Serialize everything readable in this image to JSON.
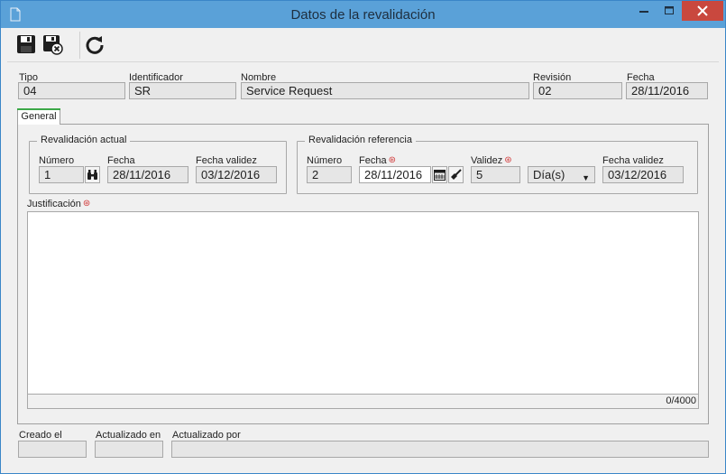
{
  "window": {
    "title": "Datos de la revalidación",
    "titlebar_color": "#5aa1d8",
    "close_color": "#c9483e"
  },
  "toolbar": {
    "buttons": [
      {
        "icon": "save-icon"
      },
      {
        "icon": "save-and-close-icon"
      },
      {
        "icon": "refresh-icon"
      }
    ]
  },
  "header": {
    "tipo_label": "Tipo",
    "tipo_value": "04",
    "identificador_label": "Identificador",
    "identificador_value": "SR",
    "nombre_label": "Nombre",
    "nombre_value": "Service Request",
    "revision_label": "Revisión",
    "revision_value": "02",
    "fecha_label": "Fecha",
    "fecha_value": "28/11/2016"
  },
  "tabs": [
    {
      "label": "General",
      "active": true,
      "accent_color": "#3ca848"
    }
  ],
  "revalidacion_actual": {
    "title": "Revalidación actual",
    "numero_label": "Número",
    "numero_value": "1",
    "fecha_label": "Fecha",
    "fecha_value": "28/11/2016",
    "fecha_validez_label": "Fecha validez",
    "fecha_validez_value": "03/12/2016"
  },
  "revalidacion_referencia": {
    "title": "Revalidación referencia",
    "numero_label": "Número",
    "numero_value": "2",
    "fecha_label": "Fecha",
    "fecha_value": "28/11/2016",
    "validez_label": "Validez",
    "validez_value": "5",
    "unit_selected": "Día(s)",
    "fecha_validez_label": "Fecha validez",
    "fecha_validez_value": "03/12/2016"
  },
  "justificacion": {
    "label": "Justificación",
    "value": "",
    "counter": "0/4000"
  },
  "footer": {
    "creado_label": "Creado el",
    "creado_value": "",
    "actualizado_en_label": "Actualizado en",
    "actualizado_en_value": "",
    "actualizado_por_label": "Actualizado por",
    "actualizado_por_value": ""
  },
  "required_color": "#d23c3c"
}
